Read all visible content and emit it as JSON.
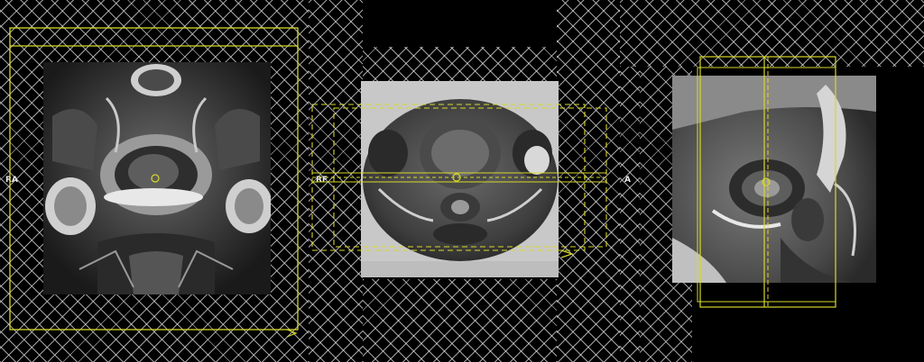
{
  "viewports": [
    {
      "orientation": "coronal",
      "label": "RA"
    },
    {
      "orientation": "axial",
      "label": "RF"
    },
    {
      "orientation": "sagittal",
      "label": "A"
    }
  ],
  "colors": {
    "planning_box": "#d8d82a",
    "divider": "#1bb3b3",
    "hatch": "#d7d7d7",
    "background": "#000000"
  }
}
